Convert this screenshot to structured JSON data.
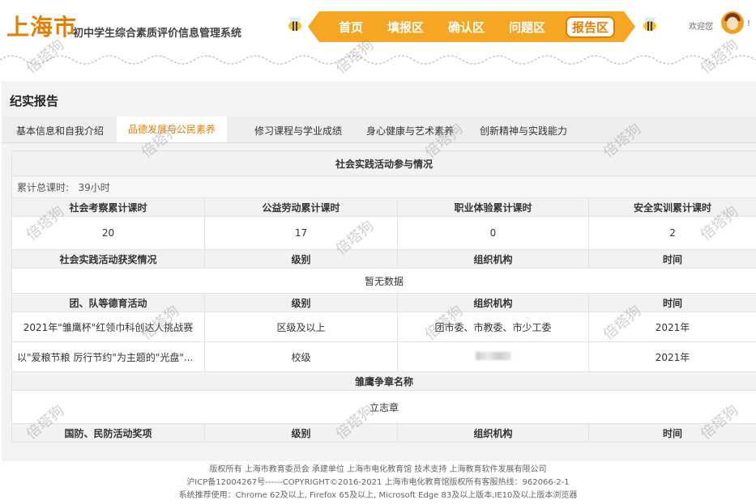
{
  "header": {
    "logo_main": "上海市",
    "logo_sub": "初中学生综合素质评价信息管理系统",
    "nav": [
      "首页",
      "填报区",
      "确认区",
      "问题区",
      "报告区"
    ],
    "nav_active": "报告区",
    "welcome": "欢迎您",
    "extra": "!",
    "accent_color": "#f5a623"
  },
  "page": {
    "title": "纪实报告"
  },
  "tabs": [
    "基本信息和自我介绍",
    "品德发展与公民素养",
    "修习课程与学业成绩",
    "身心健康与艺术素养",
    "创新精神与实践能力"
  ],
  "tabs_active": "品德发展与公民素养",
  "social": {
    "title": "社会实践活动参与情况",
    "total_label": "累计总课时:",
    "total_value": "39小时",
    "headers": [
      "社会考察累计课时",
      "公益劳动累计课时",
      "职业体验累计课时",
      "安全实训累计课时"
    ],
    "values": [
      "20",
      "17",
      "0",
      "2"
    ]
  },
  "awards": {
    "headers": [
      "社会实践活动获奖情况",
      "级别",
      "组织机构",
      "时间"
    ],
    "nodata": "暂无数据"
  },
  "league": {
    "headers": [
      "团、队等德育活动",
      "级别",
      "组织机构",
      "时间"
    ],
    "rows": [
      [
        "2021年\"雏鹰杯\"红领巾科创达人挑战赛",
        "区级及以上",
        "团市委、市教委、市少工委",
        "2021年"
      ],
      [
        "以\"爱粮节粮 厉行节约\"为主题的\"光盘\"...",
        "校级",
        "",
        "2021年"
      ]
    ]
  },
  "eagle": {
    "title": "雏鹰争章名称",
    "value": "立志章"
  },
  "defense": {
    "headers": [
      "国防、民防活动奖项",
      "级别",
      "组织机构",
      "时间"
    ]
  },
  "footer": {
    "line1": "版权所有 上海市教育委员会   承建单位 上海市电化教育馆   技术支持 上海教育软件发展有限公司",
    "line2": "沪ICP备12004267号------COPYRIGHT©2016-2021 上海市电化教育馆版权所有客服热线：962066-2-1",
    "line3": "系统推荐使用：Chrome 62及以上, Firefox 65及以上, Microsoft Edge 83及以上版本,IE10及以上版本浏览器"
  },
  "watermark": "倍塔狗"
}
